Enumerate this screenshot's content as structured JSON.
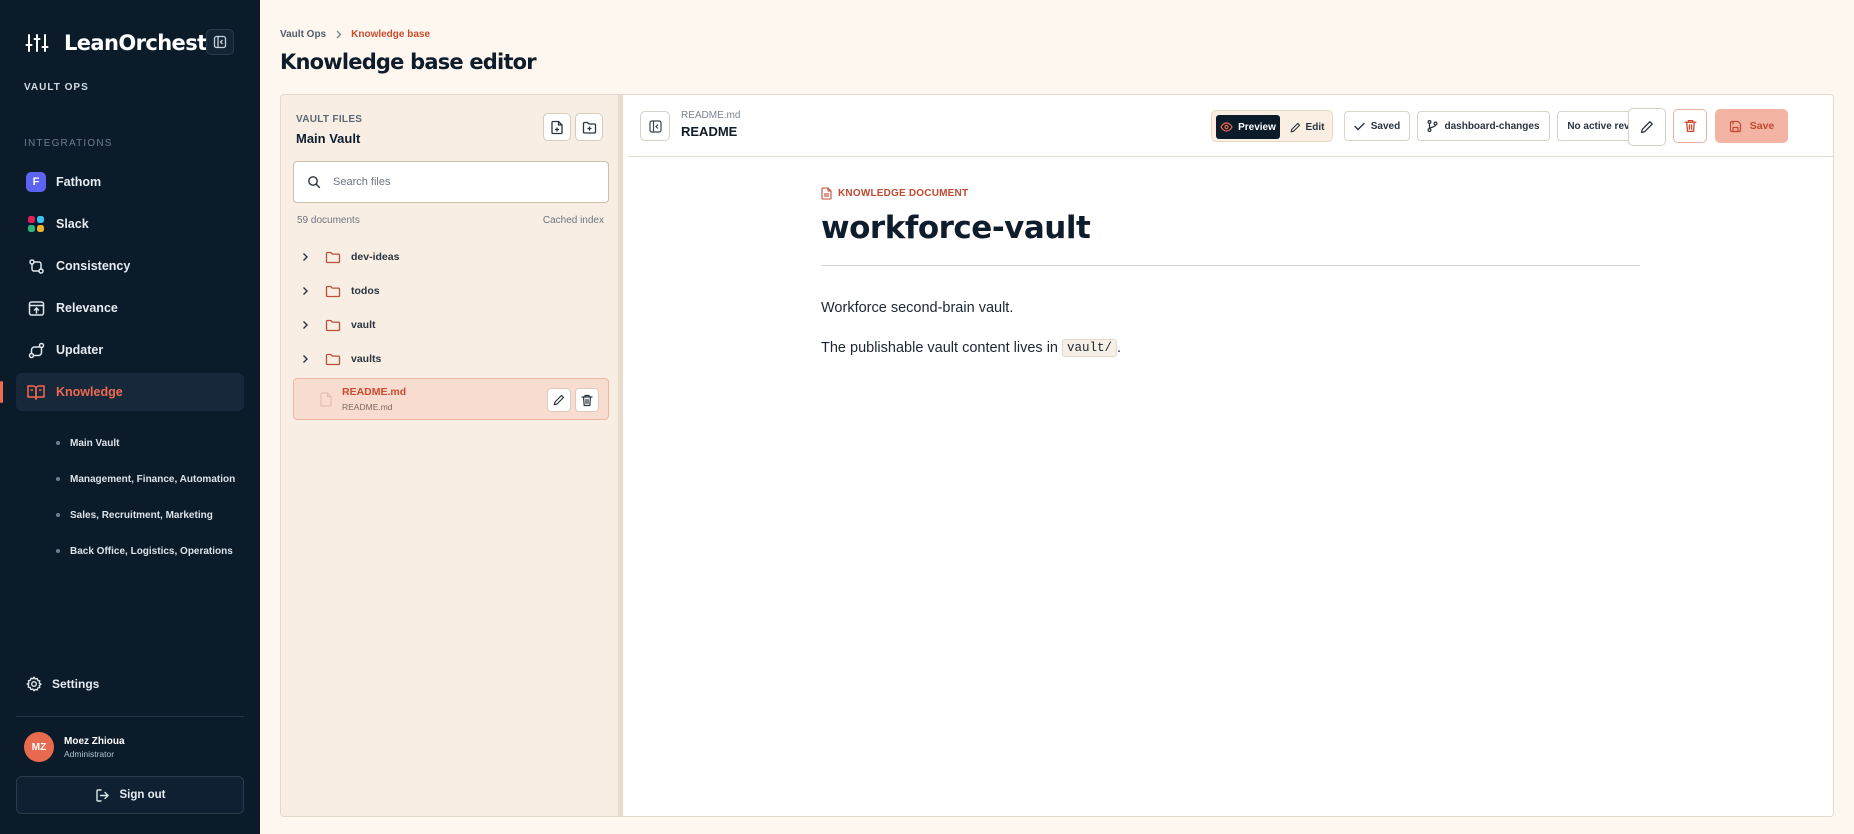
{
  "sidebar": {
    "brand": "LeanOrchestr",
    "workspace": "VAULT OPS",
    "section_label": "INTEGRATIONS",
    "items": [
      {
        "label": "Fathom",
        "badge": "F"
      },
      {
        "label": "Slack"
      },
      {
        "label": "Consistency"
      },
      {
        "label": "Relevance"
      },
      {
        "label": "Updater"
      },
      {
        "label": "Knowledge",
        "active": true
      }
    ],
    "subitems": [
      {
        "label": "Main Vault"
      },
      {
        "label": "Management, Finance, Automation"
      },
      {
        "label": "Sales, Recruitment, Marketing"
      },
      {
        "label": "Back Office, Logistics, Operations"
      }
    ],
    "settings_label": "Settings",
    "user": {
      "initials": "MZ",
      "name": "Moez Zhioua",
      "role": "Administrator"
    },
    "signout_label": "Sign out"
  },
  "header": {
    "breadcrumb": [
      "Vault Ops",
      "Knowledge base"
    ],
    "title": "Knowledge base editor"
  },
  "files": {
    "label": "VAULT FILES",
    "vault": "Main Vault",
    "search_placeholder": "Search files",
    "count": "59 documents",
    "cache": "Cached index",
    "folders": [
      {
        "name": "dev-ideas"
      },
      {
        "name": "todos"
      },
      {
        "name": "vault"
      },
      {
        "name": "vaults"
      }
    ],
    "selected_file": {
      "name": "README.md",
      "path": "README.md"
    }
  },
  "editor": {
    "file_name": "README.md",
    "doc_title": "README",
    "mode_preview": "Preview",
    "mode_edit": "Edit",
    "saved": "Saved",
    "branch": "dashboard-changes",
    "review": "No active review",
    "save": "Save"
  },
  "document": {
    "kicker": "KNOWLEDGE DOCUMENT",
    "title": "workforce-vault",
    "paragraph1": "Workforce second-brain vault.",
    "paragraph2_prefix": "The publishable vault content lives in",
    "paragraph2_code": "vault/",
    "paragraph2_suffix": "."
  },
  "colors": {
    "sidebar_bg": "#0b1b2a",
    "accent": "#ef6a4f",
    "accent_text": "#cc4b2f",
    "page_bg": "#fdf7ef",
    "file_panel_bg": "#f9eee4"
  }
}
